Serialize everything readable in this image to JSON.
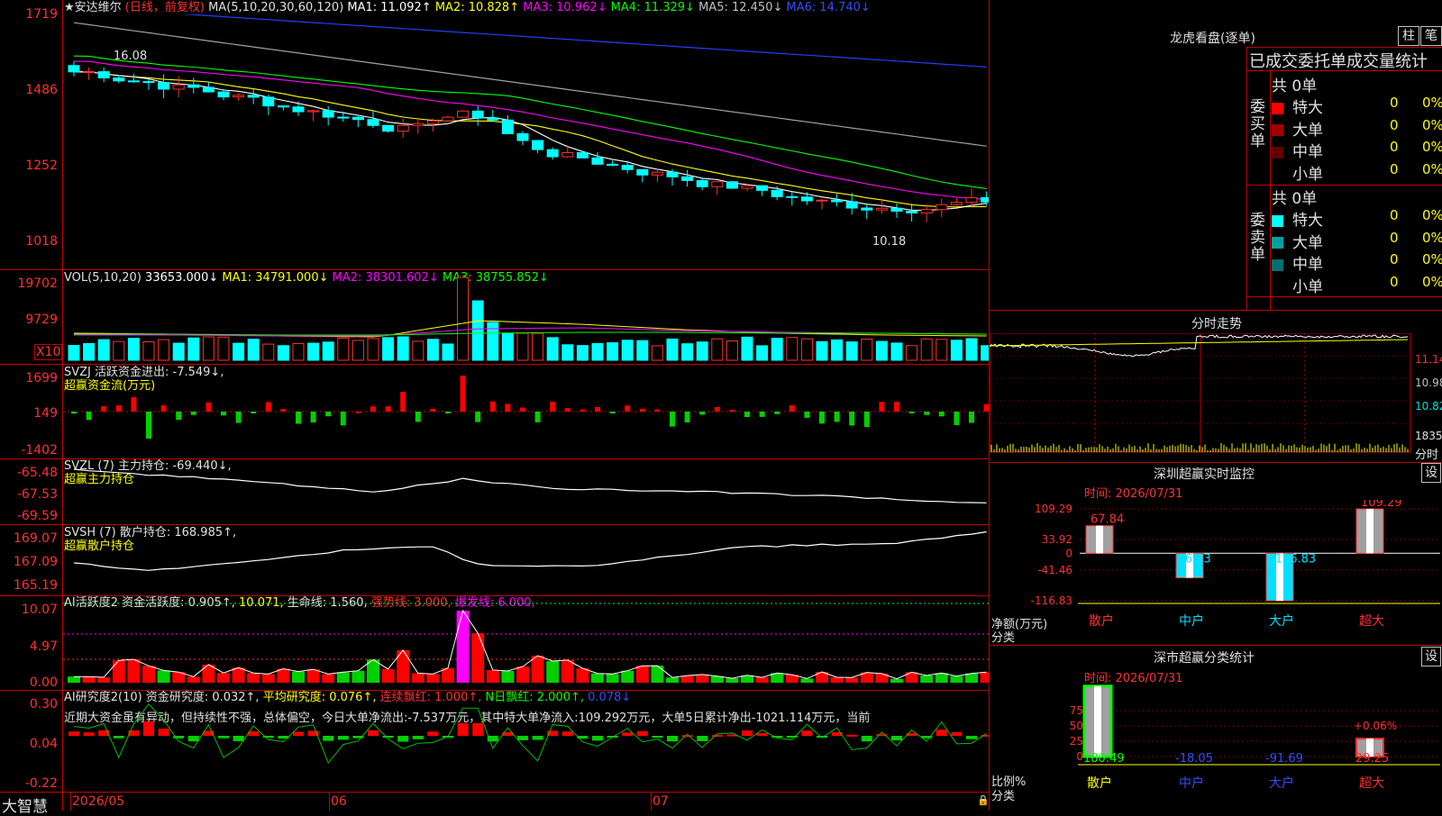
{
  "main": {
    "header": {
      "name": "★安达维尔",
      "period": "(日线，前复权)",
      "ma_def": "MA(5,10,20,30,60,120)",
      "ma1": "MA1: 11.092↑",
      "ma2": "MA2: 10.828↑",
      "ma3": "MA3: 10.962↓",
      "ma4": "MA4: 11.329↓",
      "ma5": "MA5: 12.450↓",
      "ma6": "MA6: 14.740↓"
    },
    "yticks": [
      "1719",
      "1486",
      "1252",
      "1018"
    ],
    "high_label": "16.08",
    "low_label": "10.18"
  },
  "vol": {
    "header": {
      "def": "VOL(5,10,20)",
      "value": "33653.000↓",
      "ma1": "MA1: 34791.000↓",
      "ma2": "MA2: 38301.602↓",
      "ma3": "MA3: 38755.852↓"
    },
    "yticks": [
      "19702",
      "9729"
    ],
    "unit": "X10"
  },
  "svzj": {
    "header": {
      "def": "SVZJ  活跃资金进出: -7.549↓,",
      "sub": "超赢资金流(万元)"
    },
    "yticks": [
      "1699",
      "149",
      "-1402"
    ]
  },
  "svzl": {
    "header": {
      "def": "SVZL (7) 主力持仓: -69.440↓,",
      "sub": "超赢主力持仓"
    },
    "yticks": [
      "-65.48",
      "-67.53",
      "-69.59"
    ]
  },
  "svsh": {
    "header": {
      "def": "SVSH (7) 散户持仓: 168.985↑,",
      "sub": "超赢散户持仓"
    },
    "yticks": [
      "169.07",
      "167.09",
      "165.19"
    ]
  },
  "ai1": {
    "header": {
      "def": "AI活跃度2 资金活跃度: 0.905↑,",
      "v2": "10.071,",
      "v3": "生命线: 1.560,",
      "v4": "强势线: 3.000,",
      "v5": "爆发线: 6.000,"
    },
    "yticks": [
      "10.07",
      "4.97",
      "0.00"
    ]
  },
  "ai2": {
    "header": {
      "def": "AI研究度2(10) 资金研究度: 0.032↑,",
      "v2": "平均研究度: 0.076↑,",
      "v3": "连续飘红: 1.000↑,",
      "v4": "N日飘红: 2.000↑,",
      "v5": "0.078↓"
    },
    "comment": "近期大资金虽有异动，但持续性不强，总体偏空，今日大单净流出:-7.537万元，其中特大单净流入:109.292万元，大单5日累计净出-1021.114万元，当前",
    "yticks": [
      "0.30",
      "0.04",
      "-0.22"
    ]
  },
  "xaxis": {
    "brand": "大智慧",
    "labels": [
      "2026/05",
      "06",
      "07"
    ]
  },
  "right": {
    "longhu": {
      "title": "龙虎看盘(逐单)",
      "btn1": "柱",
      "btn2": "笔",
      "tabs": "已成交委托单成交量统计",
      "buy": {
        "side": "委买单",
        "total": "共 0单",
        "rows": [
          {
            "label": "特大",
            "count": "0",
            "pct": "0%",
            "color": "#ff0000"
          },
          {
            "label": "大单",
            "count": "0",
            "pct": "0%",
            "color": "#a00000"
          },
          {
            "label": "中单",
            "count": "0",
            "pct": "0%",
            "color": "#600000"
          },
          {
            "label": "小单",
            "count": "0",
            "pct": "0%",
            "color": ""
          }
        ]
      },
      "sell": {
        "side": "委卖单",
        "total": "共 0单",
        "rows": [
          {
            "label": "特大",
            "count": "0",
            "pct": "0%",
            "color": "#00ffff"
          },
          {
            "label": "大单",
            "count": "0",
            "pct": "0%",
            "color": "#00a0a0"
          },
          {
            "label": "中单",
            "count": "0",
            "pct": "0%",
            "color": "#007070"
          },
          {
            "label": "小单",
            "count": "0",
            "pct": "0%",
            "color": ""
          }
        ]
      }
    },
    "fenshi": {
      "title": "分时走势",
      "yticks": [
        "11.14",
        "10.98",
        "10.82",
        "1835"
      ],
      "unit": "分时"
    },
    "monitor": {
      "title": "深圳超赢实时监控",
      "btn": "设",
      "time": "时间: 2026/07/31",
      "yticks": [
        "109.29",
        "33.92",
        "0",
        "-41.46",
        "-116.83"
      ],
      "ylabel1": "净额(万元)",
      "ylabel2": "分类",
      "cats": [
        "散户",
        "中户",
        "大户",
        "超大"
      ],
      "values": [
        67.84,
        -60.3,
        -116.83,
        109.29
      ],
      "value_labels": [
        "67.84",
        "-60.3",
        "-116.83",
        "109.29"
      ]
    },
    "classify": {
      "title": "深市超赢分类统计",
      "btn": "设",
      "time": "时间: 2026/07/31",
      "yticks": [
        "75",
        "50",
        "25",
        "0"
      ],
      "ylabel1": "比例%",
      "ylabel2": "分类",
      "cats": [
        "散户",
        "中户",
        "大户",
        "超大"
      ],
      "values": [
        180.49,
        -18.05,
        -91.69,
        29.25
      ],
      "value_labels": [
        "180.49",
        "-18.05",
        "-91.69",
        "29.25"
      ],
      "extra_label": "+0.06%"
    }
  }
}
